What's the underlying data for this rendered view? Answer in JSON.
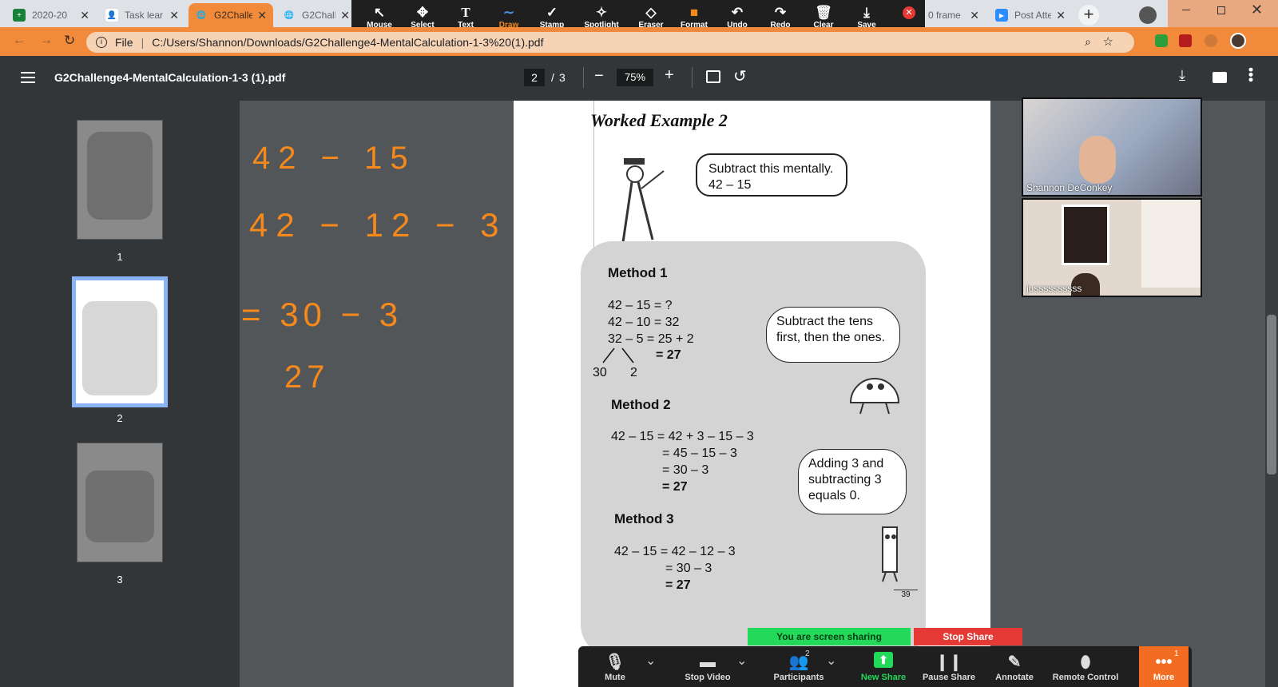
{
  "browser": {
    "tabs": [
      {
        "title": "2020-20",
        "color": "#188038",
        "glyph": "+"
      },
      {
        "title": "Task lear",
        "color": "#f1f3f4",
        "glyph": "👤"
      },
      {
        "title": "G2Challe",
        "color": "#5f6368",
        "glyph": "🌐"
      },
      {
        "title": "G2Challe",
        "color": "#5f6368",
        "glyph": "🌐"
      },
      {
        "title": "0 frame",
        "color": "#e53935",
        "glyph": ""
      },
      {
        "title": "Post Atte",
        "color": "#2d8cff",
        "glyph": "▶"
      }
    ],
    "close_glyph": "✕",
    "new_tab_glyph": "+",
    "omnibox": {
      "prefix": "File",
      "url": "C:/Users/Shannon/Downloads/G2Challenge4-MentalCalculation-1-3%20(1).pdf"
    }
  },
  "annotate_toolbar": {
    "tools": [
      {
        "label": "Mouse",
        "icon": "↖"
      },
      {
        "label": "Select",
        "icon": "✥"
      },
      {
        "label": "Text",
        "icon": "T"
      },
      {
        "label": "Draw",
        "icon": "∼"
      },
      {
        "label": "Stamp",
        "icon": "✓"
      },
      {
        "label": "Spotlight",
        "icon": "✧"
      },
      {
        "label": "Eraser",
        "icon": "◇"
      },
      {
        "label": "Format",
        "icon": "■"
      },
      {
        "label": "Undo",
        "icon": "↶"
      },
      {
        "label": "Redo",
        "icon": "↷"
      },
      {
        "label": "Clear",
        "icon": "🗑"
      },
      {
        "label": "Save",
        "icon": "⤓"
      }
    ],
    "selected": "Draw",
    "format_color": "#f5891c"
  },
  "pdf_viewer": {
    "filename": "G2Challenge4-MentalCalculation-1-3 (1).pdf",
    "current_page": "2",
    "page_sep": "/",
    "total_pages": "3",
    "zoom": "75%",
    "thumb_labels": [
      "1",
      "2",
      "3"
    ]
  },
  "handwriting": {
    "color": "#f5891c",
    "lines": [
      "42 − 15",
      "42 − 12 − 3",
      "= 30 − 3",
      "27"
    ]
  },
  "worksheet": {
    "title": "Worked Example 2",
    "question_line1": "Subtract this mentally.",
    "question_line2": "42 – 15",
    "m1_title": "Method 1",
    "m1_lines": [
      "42 – 15 = ?",
      "42 – 10 = 32",
      "32 – 5  = 25 + 2"
    ],
    "m1_result": "= 27",
    "m1_split": [
      "30",
      "2"
    ],
    "m1_bubble": "Subtract the tens first, then the ones.",
    "m2_title": "Method 2",
    "m2_lines": [
      "42 – 15 = 42 + 3 – 15 – 3",
      "= 45 – 15 – 3",
      "= 30 – 3"
    ],
    "m2_result": "= 27",
    "m2_bubble": "Adding 3 and subtracting 3 equals 0.",
    "m3_title": "Method 3",
    "m3_lines": [
      "42 – 15 = 42 – 12 – 3",
      "= 30 – 3"
    ],
    "m3_result": "= 27",
    "page_number": "39"
  },
  "participants_video": [
    {
      "name": "Shannon DeConkey"
    },
    {
      "name": "jussssssssss"
    }
  ],
  "zoom_meeting": {
    "sharing_text": "You are screen sharing",
    "stop_share": "Stop Share",
    "buttons": [
      {
        "label": "Mute",
        "icon": "🎙"
      },
      {
        "label": "Stop Video",
        "icon": "▬"
      },
      {
        "label": "Participants",
        "icon": "👥",
        "badge": "2"
      },
      {
        "label": "New Share",
        "icon": "⬆"
      },
      {
        "label": "Pause Share",
        "icon": "❙❙"
      },
      {
        "label": "Annotate",
        "icon": "✎"
      },
      {
        "label": "Remote Control",
        "icon": "⬮"
      },
      {
        "label": "More",
        "icon": "•••",
        "badge": "1"
      }
    ],
    "chevron": "⌄",
    "accent": "#f26d21",
    "share_green": "#23d959"
  }
}
